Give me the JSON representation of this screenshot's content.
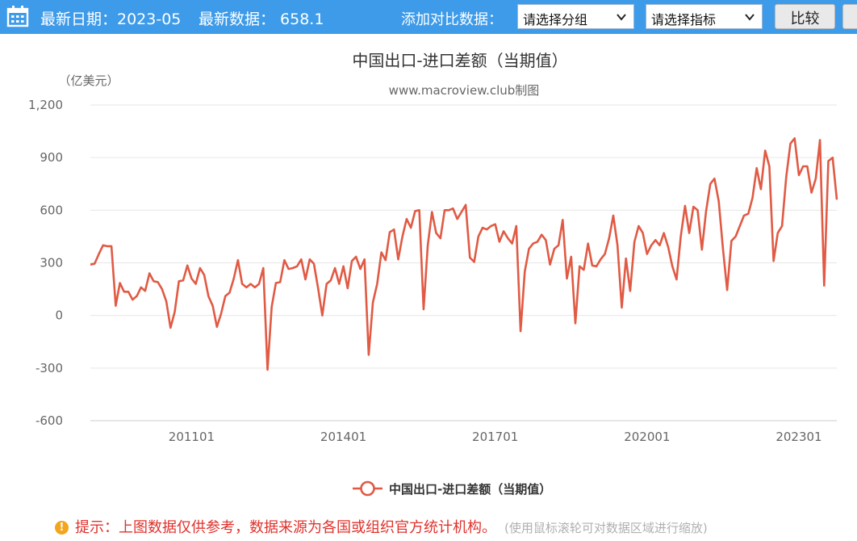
{
  "toolbar": {
    "latest_date_label": "最新日期：2023-05",
    "latest_value_label": "最新数据：  658.1",
    "compare_label": "添加对比数据：",
    "group_select": "请选择分组",
    "indicator_select": "请选择指标",
    "compare_button": "比较",
    "calendar_icon": "calendar-icon"
  },
  "chart_data": {
    "type": "line",
    "title": "中国出口-进口差额（当期值）",
    "subtitle": "www.macroview.club制图",
    "ylabel": "（亿美元）",
    "ylim": [
      -600,
      1200
    ],
    "yticks": [
      "1,200",
      "900",
      "600",
      "300",
      "0",
      "-300",
      "-600"
    ],
    "ytick_values": [
      1200,
      900,
      600,
      300,
      0,
      -300,
      -600
    ],
    "xticks": [
      "201101",
      "201401",
      "201701",
      "202001",
      "202301"
    ],
    "xtick_index": [
      24,
      60,
      96,
      132,
      168
    ],
    "grid": true,
    "legend": "bottom-center",
    "line_color": "#e05a44",
    "x_start": "200901",
    "x_end": "202305",
    "series": [
      {
        "name": "中国出口-进口差额（当期值）",
        "values": [
          290,
          295,
          350,
          400,
          395,
          395,
          55,
          185,
          135,
          135,
          90,
          110,
          160,
          140,
          240,
          195,
          190,
          150,
          80,
          -70,
          20,
          195,
          200,
          285,
          210,
          180,
          270,
          230,
          110,
          55,
          -65,
          10,
          110,
          130,
          210,
          315,
          180,
          160,
          180,
          160,
          180,
          270,
          -310,
          50,
          185,
          190,
          315,
          265,
          270,
          280,
          320,
          205,
          320,
          295,
          155,
          0,
          180,
          200,
          270,
          180,
          280,
          155,
          310,
          335,
          265,
          320,
          -225,
          75,
          180,
          360,
          315,
          475,
          490,
          320,
          450,
          550,
          500,
          595,
          600,
          35,
          400,
          590,
          470,
          440,
          600,
          600,
          610,
          550,
          590,
          630,
          330,
          305,
          450,
          500,
          490,
          510,
          520,
          420,
          480,
          440,
          410,
          510,
          -90,
          250,
          380,
          410,
          420,
          460,
          430,
          290,
          380,
          400,
          545,
          210,
          335,
          -45,
          280,
          260,
          410,
          285,
          280,
          320,
          350,
          440,
          570,
          400,
          45,
          325,
          140,
          420,
          510,
          470,
          350,
          400,
          430,
          400,
          470,
          390,
          280,
          205,
          450,
          625,
          470,
          620,
          600,
          375,
          595,
          750,
          780,
          650,
          380,
          145,
          425,
          450,
          510,
          570,
          580,
          670,
          840,
          720,
          940,
          850,
          310,
          470,
          510,
          790,
          980,
          1010,
          800,
          850,
          850,
          700,
          780,
          1000,
          170,
          880,
          900,
          660
        ]
      }
    ]
  },
  "legend": {
    "label": "中国出口-进口差额（当期值）"
  },
  "footer": {
    "hint_icon": "!",
    "hint": "提示：上图数据仅供参考，数据来源为各国或组织官方统计机构。",
    "subhint": "(使用鼠标滚轮可对数据区域进行缩放)"
  }
}
